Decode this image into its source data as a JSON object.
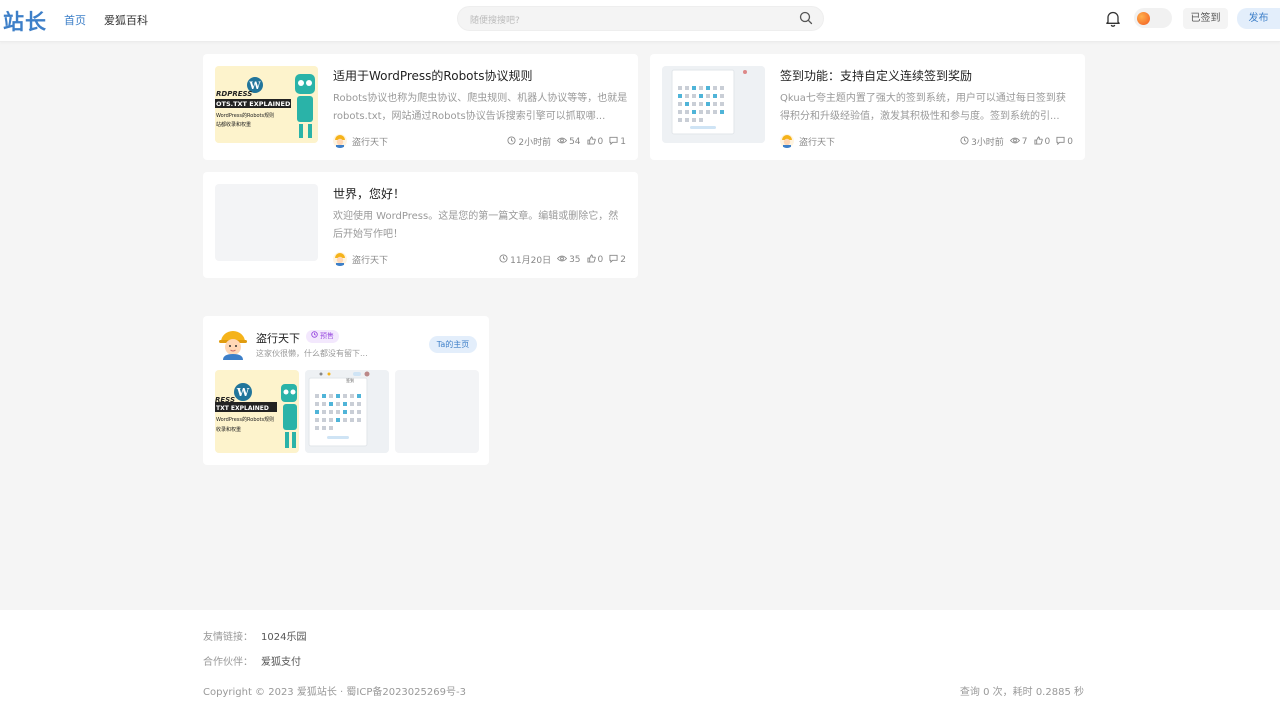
{
  "header": {
    "logo": "站长",
    "nav": [
      {
        "label": "首页",
        "active": true
      },
      {
        "label": "爱狐百科",
        "active": false
      }
    ],
    "search_placeholder": "随便搜搜吧?",
    "signed_label": "已签到",
    "publish_label": "发布"
  },
  "posts": [
    {
      "title": "适用于WordPress的Robots协议规则",
      "excerpt": "Robots协议也称为爬虫协议、爬虫规则、机器人协议等等，也就是robots.txt，网站通过Robots协议告诉搜索引擎可以抓取哪...",
      "author": "盗行天下",
      "time": "2小时前",
      "views": "54",
      "likes": "0",
      "comments": "1",
      "thumb_text": [
        "RDPRESS",
        "OTS.TXT EXPLAINED",
        "WordPress的Robots规则",
        "站都收录和权重"
      ]
    },
    {
      "title": "签到功能：支持自定义连续签到奖励",
      "excerpt": "Qkua七夸主题内置了强大的签到系统，用户可以通过每日签到获得积分和升级经验值，激发其积极性和参与度。签到系统的引...",
      "author": "盗行天下",
      "time": "3小时前",
      "views": "7",
      "likes": "0",
      "comments": "0"
    },
    {
      "title": "世界，您好！",
      "excerpt": "欢迎使用 WordPress。这是您的第一篇文章。编辑或删除它，然后开始写作吧！",
      "author": "盗行天下",
      "time": "11月20日",
      "views": "35",
      "likes": "0",
      "comments": "2"
    }
  ],
  "author_box": {
    "name": "盗行天下",
    "badge": "预售",
    "bio": "这家伙很懒，什么都没有留下...",
    "homepage_label": "Ta的主页",
    "thumb1_text": [
      "RESS",
      "TXT EXPLAINED",
      "WordPress的Robots规则",
      "收录和权重"
    ],
    "thumb2_text": "签到"
  },
  "footer": {
    "friend_links_label": "友情链接：",
    "friend_links_value": "1024乐园",
    "partners_label": "合作伙伴：",
    "partners_value": "爱狐支付",
    "copyright": "Copyright © 2023 爱狐站长 · 蜀ICP备2023025269号-3",
    "query": "查询 0 次，耗时 0.2885 秒"
  },
  "colors": {
    "accent": "#3d7fc8",
    "background": "#f5f5f5",
    "badge": "#9b50e0"
  }
}
